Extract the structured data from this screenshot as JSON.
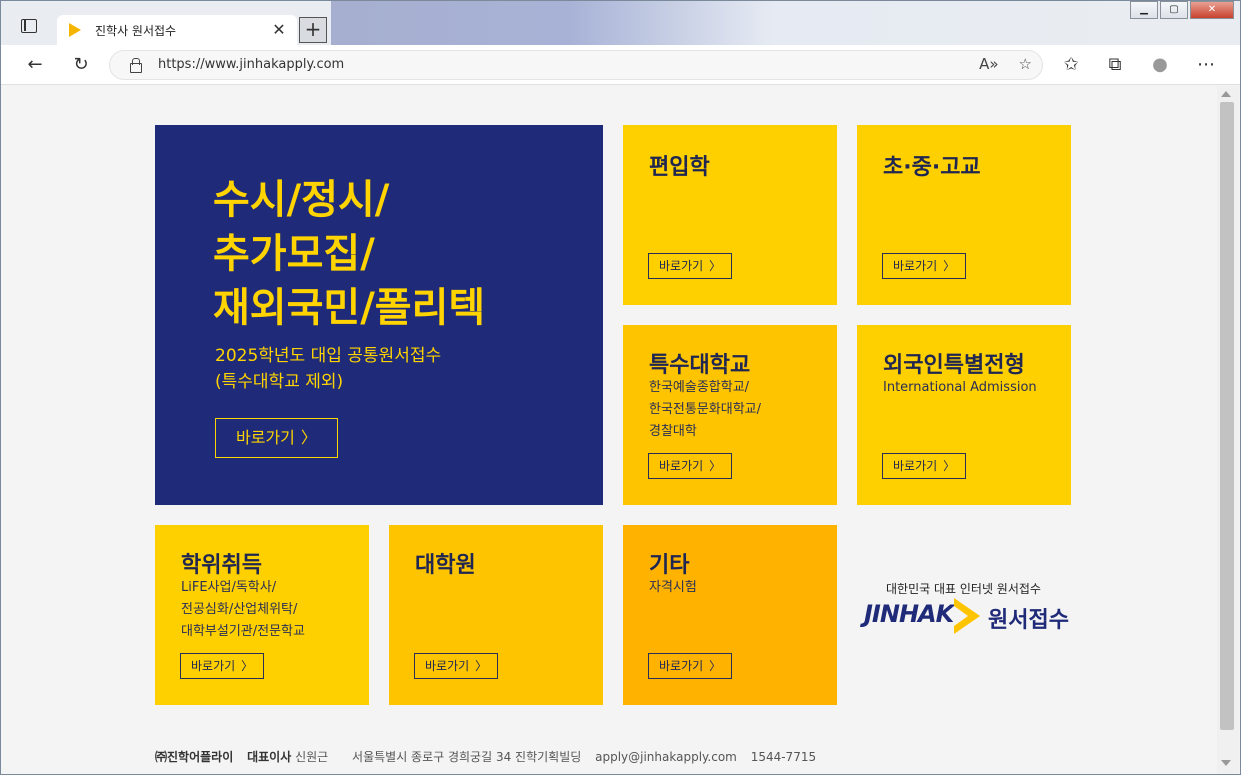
{
  "browser": {
    "tab_title": "진학사 원서접수",
    "url": "https://www.jinhakapply.com",
    "new_tab": "+",
    "close_tab": "✕"
  },
  "main": {
    "headline_1": "수시/정시/",
    "headline_2": "추가모집/",
    "headline_3": "재외국민/폴리텍",
    "desc_1": "2025학년도 대입 공통원서접수",
    "desc_2": "(특수대학교 제외)",
    "go": "바로가기"
  },
  "tiles": {
    "transfer": {
      "title": "편입학",
      "go": "바로가기"
    },
    "school": {
      "title": "초·중·고교",
      "go": "바로가기"
    },
    "special": {
      "title": "특수대학교",
      "sub_1": "한국예술종합학교/",
      "sub_2": "한국전통문화대학교/",
      "sub_3": "경찰대학",
      "go": "바로가기"
    },
    "foreign": {
      "title": "외국인특별전형",
      "sub_1": "International Admission",
      "go": "바로가기"
    },
    "degree": {
      "title": "학위취득",
      "sub_1": "LiFE사업/독학사/",
      "sub_2": "전공심화/산업체위탁/",
      "sub_3": "대학부설기관/전문학교",
      "go": "바로가기"
    },
    "grad": {
      "title": "대학원",
      "go": "바로가기"
    },
    "etc": {
      "title": "기타",
      "sub_1": "자격시험",
      "go": "바로가기"
    }
  },
  "logo": {
    "slogan": "대한민국 대표 인터넷 원서접수",
    "brand": "JINHAK",
    "kr": "원서접수"
  },
  "footer": {
    "company": "㈜진학어플라이",
    "ceo_label": "대표이사",
    "ceo": "신원근",
    "address": "서울특별시 종로구 경희궁길 34 진학기획빌딩",
    "email": "apply@jinhakapply.com",
    "phone": "1544-7715"
  },
  "colors": {
    "navy": "#1f2a78",
    "yellow": "#ffd000",
    "yellow_dark": "#ffb300"
  }
}
